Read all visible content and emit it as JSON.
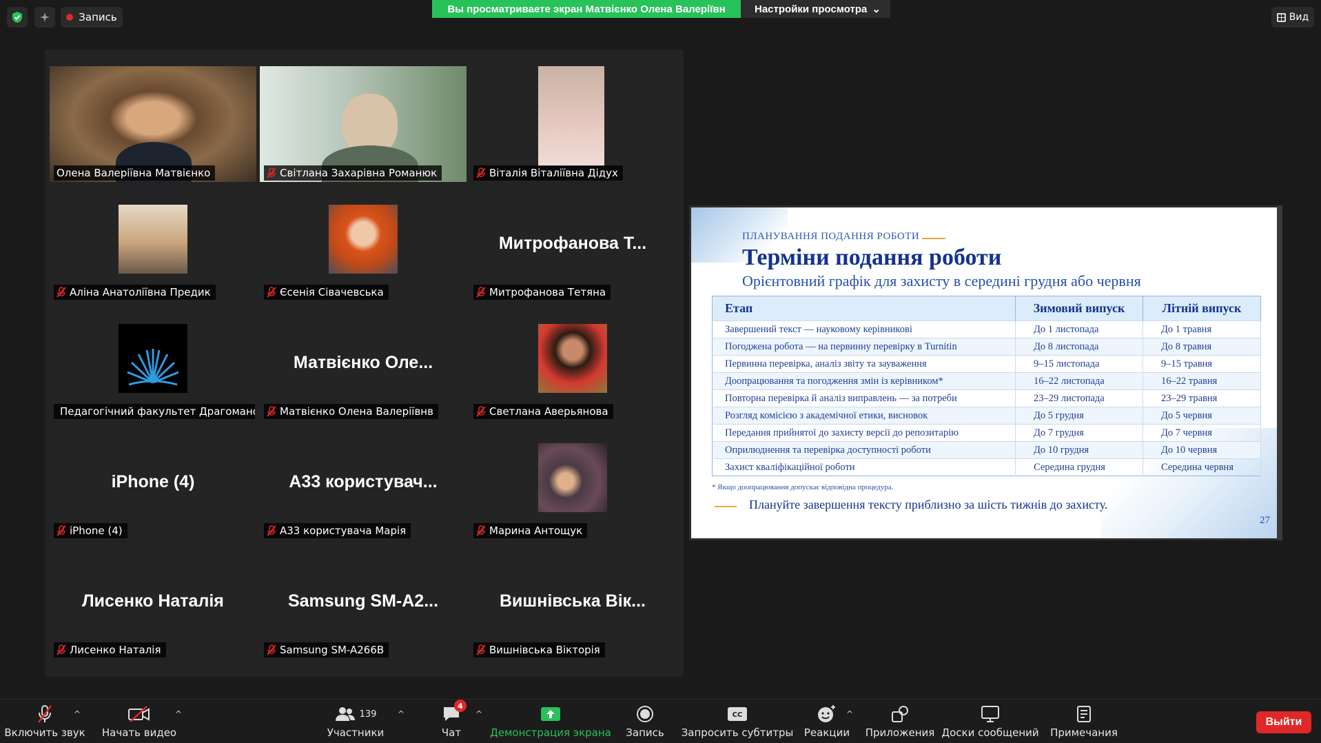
{
  "top": {
    "record_label": "Запись",
    "share_banner": "Вы просматриваете экран Матвієнко Олена Валеріївн",
    "view_options": "Настройки просмотра",
    "view_label": "Вид"
  },
  "participants": [
    {
      "name": "Олена Валеріївна Матвієнко",
      "big": "",
      "muted": false,
      "kind": "video1"
    },
    {
      "name": "Світлана Захарівна Романюк",
      "big": "",
      "muted": true,
      "kind": "video2"
    },
    {
      "name": "Віталія Віталіївна Дідух",
      "big": "",
      "muted": true,
      "kind": "video3"
    },
    {
      "name": "Аліна Анатоліївна Предик",
      "big": "",
      "muted": true,
      "kind": "photo1"
    },
    {
      "name": "Єсенія Сівачевська",
      "big": "",
      "muted": true,
      "kind": "photo2"
    },
    {
      "name": "Митрофанова Тетяна",
      "big": "Митрофанова Т...",
      "muted": true,
      "kind": "text"
    },
    {
      "name": "Педагогічний факультет Драгомано...",
      "big": "",
      "muted": true,
      "kind": "logo"
    },
    {
      "name": "Матвієнко Олена Валеріївнв",
      "big": "Матвієнко Оле...",
      "muted": true,
      "kind": "text"
    },
    {
      "name": "Светлана Аверьянова",
      "big": "",
      "muted": true,
      "kind": "photo3"
    },
    {
      "name": "iPhone (4)",
      "big": "iPhone (4)",
      "muted": true,
      "kind": "text"
    },
    {
      "name": "А33 користувача Марія",
      "big": "А33  користувач...",
      "muted": true,
      "kind": "text"
    },
    {
      "name": "Марина Антощук",
      "big": "",
      "muted": true,
      "kind": "photo4"
    },
    {
      "name": "Лисенко Наталія",
      "big": "Лисенко Наталія",
      "muted": true,
      "kind": "text"
    },
    {
      "name": "Samsung SM-A266B",
      "big": "Samsung  SM-A2...",
      "muted": true,
      "kind": "text"
    },
    {
      "name": "Вишнівська Вікторія",
      "big": "Вишнівська Вік...",
      "muted": true,
      "kind": "text"
    }
  ],
  "slide": {
    "kicker": "ПЛАНУВАННЯ ПОДАННЯ РОБОТИ",
    "title": "Терміни подання роботи",
    "subtitle": "Орієнтовний графік для захисту в середині грудня або червня",
    "headers": [
      "Етап",
      "Зимовий випуск",
      "Літній випуск"
    ],
    "rows": [
      [
        "Завершений текст — науковому керівникові",
        "До 1 листопада",
        "До 1 травня"
      ],
      [
        "Погоджена робота — на первинну перевірку в Turnitin",
        "До 8 листопада",
        "До 8 травня"
      ],
      [
        "Первинна перевірка, аналіз звіту та зауваження",
        "9–15 листопада",
        "9–15 травня"
      ],
      [
        "Доопрацювання та погодження змін із керівником*",
        "16–22 листопада",
        "16–22 травня"
      ],
      [
        "Повторна перевірка й аналіз виправлень — за потреби",
        "23–29 листопада",
        "23–29 травня"
      ],
      [
        "Розгляд комісією з академічної етики, висновок",
        "До 5 грудня",
        "До 5 червня"
      ],
      [
        "Передання прийнятої до захисту версії до репозитарію",
        "До 7 грудня",
        "До 7 червня"
      ],
      [
        "Оприлюднення та перевірка доступності роботи",
        "До 10 грудня",
        "До 10 червня"
      ],
      [
        "Захист кваліфікаційної роботи",
        "Середина грудня",
        "Середина червня"
      ]
    ],
    "note": "* Якщо доопрацювання допускає відповідна процедура.",
    "tip": "Плануйте завершення тексту приблизно за шість тижнів до захисту.",
    "page_number": "27"
  },
  "toolbar": {
    "unmute": "Включить звук",
    "start_video": "Начать видео",
    "participants": "Участники",
    "participants_count": "139",
    "chat": "Чат",
    "chat_badge": "4",
    "share": "Демонстрация экрана",
    "record": "Запись",
    "captions": "Запросить субтитры",
    "reactions": "Реакции",
    "apps": "Приложения",
    "whiteboards": "Доски сообщений",
    "notes": "Примечания",
    "leave": "Выйти"
  },
  "colors": {
    "share_green": "#27c25a",
    "leave_red": "#e02828",
    "active_speaker": "#e7e64a"
  }
}
